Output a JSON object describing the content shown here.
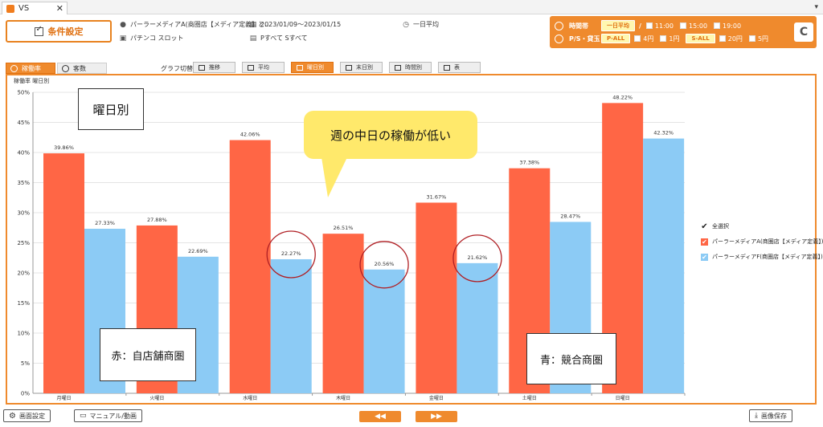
{
  "window": {
    "tab_title": "VS",
    "close_glyph": "✕",
    "menu_glyph": "▾"
  },
  "toolbar": {
    "condition_button": "条件設定"
  },
  "info": {
    "store": "パーラーメディアA(商圏店【メディア定義】と...",
    "machine_type": "パチンコ スロット",
    "date_range": "2023/01/09〜2023/01/15",
    "machines": "Pすべて Sすべて",
    "average": "一日平均"
  },
  "filter_panel": {
    "time_label": "時間帯",
    "time_chip": "一日平均",
    "time_separator": "/",
    "times": [
      "11:00",
      "15:00",
      "19:00"
    ],
    "rental_label": "P/S・貸玉",
    "p_chip": "P-ALL",
    "p_options": [
      "4円",
      "1円"
    ],
    "s_chip": "S-ALL",
    "s_options": [
      "20円",
      "5円"
    ],
    "refresh_glyph": "C"
  },
  "mode_tabs": [
    "稼働率",
    "客数"
  ],
  "graph_switch_label": "グラフ切替",
  "graph_buttons": [
    "推移",
    "平均",
    "曜日別",
    "末日別",
    "時間別",
    "表"
  ],
  "colors": {
    "accent": "#ef8a2d",
    "series_a": "#ff6645",
    "series_b": "#8ccbf5",
    "circle": "#b01f24"
  },
  "chart_data": {
    "type": "bar",
    "title": "稼働率 曜日別",
    "categories": [
      "月曜日",
      "火曜日",
      "水曜日",
      "木曜日",
      "金曜日",
      "土曜日",
      "日曜日"
    ],
    "series": [
      {
        "name": "パーラーメディアA(商圏店【メディア定義】)",
        "values": [
          39.86,
          27.88,
          42.06,
          26.51,
          31.67,
          37.38,
          48.22
        ],
        "labels": [
          "39.86%",
          "27.88%",
          "42.06%",
          "26.51%",
          "31.67%",
          "37.38%",
          "48.22%"
        ]
      },
      {
        "name": "パーラーメディアF(商圏店【メディア定義】)",
        "values": [
          27.33,
          22.69,
          22.27,
          20.56,
          21.62,
          28.47,
          42.32
        ],
        "labels": [
          "27.33%",
          "22.69%",
          "22.27%",
          "20.56%",
          "21.62%",
          "28.47%",
          "42.32%"
        ]
      }
    ],
    "ylim": [
      0,
      50
    ],
    "yticks": [
      "0%",
      "5%",
      "10%",
      "15%",
      "20%",
      "25%",
      "30%",
      "35%",
      "40%",
      "45%",
      "50%"
    ],
    "highlighted": [
      2,
      3,
      4
    ],
    "legend": {
      "select_all": "全選択",
      "placement": "right"
    },
    "grid": true
  },
  "annotations": {
    "heading": "曜日別",
    "bubble": "週の中日の稼働が低い",
    "red_note": "赤：自店舗商圏",
    "blue_note": "青：競合商圏"
  },
  "bottom": {
    "screen_settings": "画面設定",
    "manual": "マニュアル/動画",
    "prev": "◀◀",
    "next": "▶▶",
    "save_image": "画像保存"
  }
}
